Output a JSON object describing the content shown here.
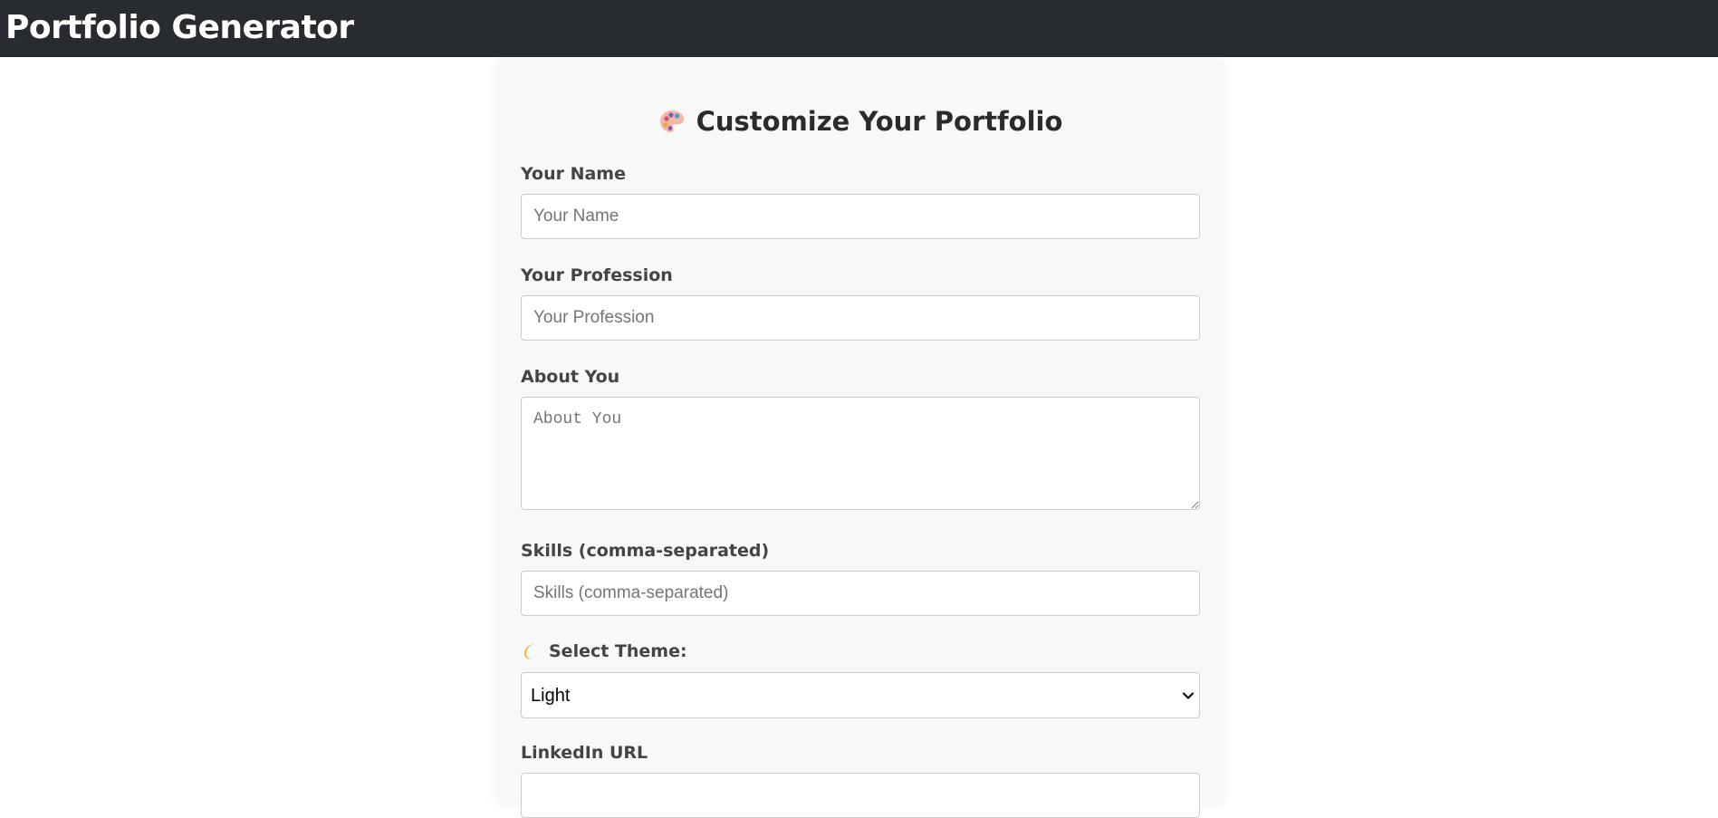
{
  "header": {
    "title": "Portfolio Generator"
  },
  "form": {
    "heading": "Customize Your Portfolio",
    "heading_icon": "palette-icon",
    "name": {
      "label": "Your Name",
      "placeholder": "Your Name",
      "value": ""
    },
    "profession": {
      "label": "Your Profession",
      "placeholder": "Your Profession",
      "value": ""
    },
    "about": {
      "label": "About You",
      "placeholder": "About You",
      "value": ""
    },
    "skills": {
      "label": "Skills (comma-separated)",
      "placeholder": "Skills (comma-separated)",
      "value": ""
    },
    "theme": {
      "label": "Select Theme:",
      "icon": "moon-icon",
      "selected": "Light"
    },
    "linkedin": {
      "label": "LinkedIn URL"
    }
  },
  "colors": {
    "header_bg": "#282b30",
    "card_bg": "#f8f8f8",
    "label_text": "#444444"
  }
}
